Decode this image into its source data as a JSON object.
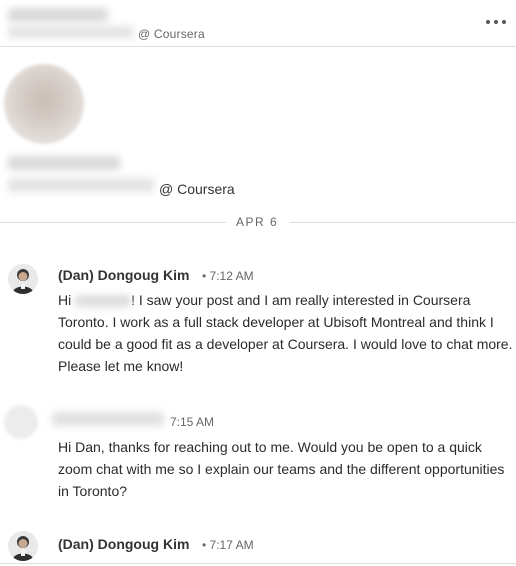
{
  "header": {
    "company": "@ Coursera",
    "more_icon": "more-horizontal-icon"
  },
  "profile": {
    "company": "@ Coursera"
  },
  "date_divider": "APR 6",
  "messages": [
    {
      "sender": "(Dan) Dongoug Kim",
      "time": "• 7:12 AM",
      "text_prefix": "Hi",
      "text": "! I saw your post and I am really interested in Coursera Toronto. I work as a full stack developer at Ubisoft Montreal and think I could be a good fit as a developer at Coursera. I would love to chat more. Please let me know!"
    },
    {
      "sender": "",
      "time": "7:15 AM",
      "text": "Hi Dan, thanks for reaching out to me. Would you be open to a quick zoom chat with me so I explain our teams and the different opportunities in Toronto?"
    },
    {
      "sender": "(Dan) Dongoug Kim",
      "time": "• 7:17 AM"
    }
  ]
}
